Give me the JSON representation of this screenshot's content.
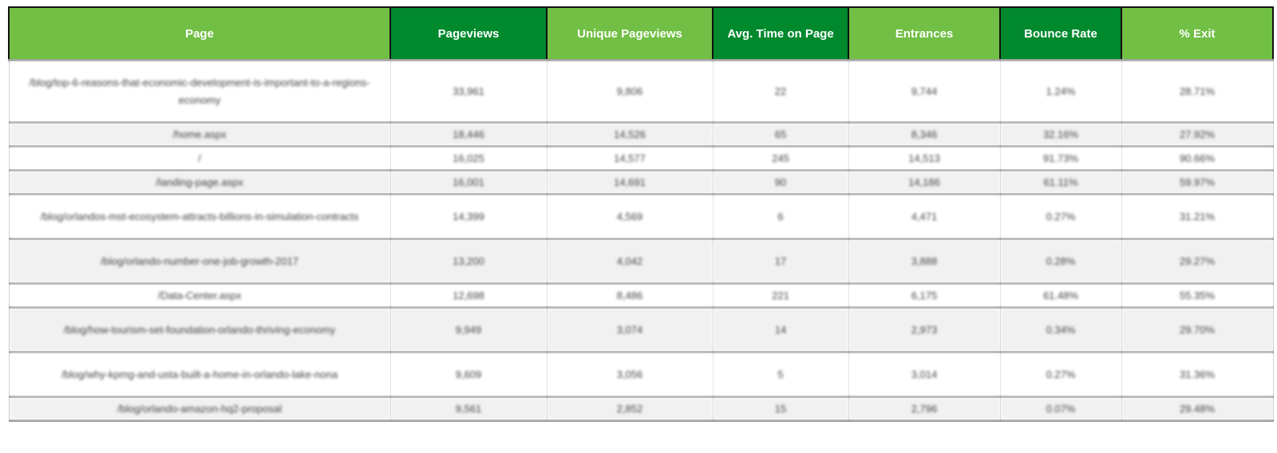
{
  "table": {
    "headers": [
      {
        "label": "Page",
        "style": "light"
      },
      {
        "label": "Pageviews",
        "style": "dark"
      },
      {
        "label": "Unique Pageviews",
        "style": "light"
      },
      {
        "label": "Avg. Time on Page",
        "style": "dark"
      },
      {
        "label": "Entrances",
        "style": "light"
      },
      {
        "label": "Bounce Rate",
        "style": "dark"
      },
      {
        "label": "% Exit",
        "style": "light"
      }
    ],
    "rows": [
      {
        "page": "/blog/top-6-reasons-that-economic-development-is-important-to-a-regions-economy",
        "pageviews": "33,961",
        "unique_pageviews": "9,806",
        "avg_time": "22",
        "entrances": "9,744",
        "bounce_rate": "1.24%",
        "exit": "28.71%"
      },
      {
        "page": "/home.aspx",
        "pageviews": "18,446",
        "unique_pageviews": "14,526",
        "avg_time": "65",
        "entrances": "8,346",
        "bounce_rate": "32.16%",
        "exit": "27.92%"
      },
      {
        "page": "/",
        "pageviews": "16,025",
        "unique_pageviews": "14,577",
        "avg_time": "245",
        "entrances": "14,513",
        "bounce_rate": "91.73%",
        "exit": "90.66%"
      },
      {
        "page": "/landing-page.aspx",
        "pageviews": "16,001",
        "unique_pageviews": "14,691",
        "avg_time": "90",
        "entrances": "14,186",
        "bounce_rate": "61.11%",
        "exit": "59.97%"
      },
      {
        "page": "/blog/orlandos-mst-ecosystem-attracts-billions-in-simulation-contracts",
        "pageviews": "14,399",
        "unique_pageviews": "4,569",
        "avg_time": "6",
        "entrances": "4,471",
        "bounce_rate": "0.27%",
        "exit": "31.21%"
      },
      {
        "page": "/blog/orlando-number-one-job-growth-2017",
        "pageviews": "13,200",
        "unique_pageviews": "4,042",
        "avg_time": "17",
        "entrances": "3,888",
        "bounce_rate": "0.28%",
        "exit": "29.27%"
      },
      {
        "page": "/Data-Center.aspx",
        "pageviews": "12,698",
        "unique_pageviews": "8,486",
        "avg_time": "221",
        "entrances": "6,175",
        "bounce_rate": "61.48%",
        "exit": "55.35%"
      },
      {
        "page": "/blog/how-tourism-set-foundation-orlando-thriving-economy",
        "pageviews": "9,949",
        "unique_pageviews": "3,074",
        "avg_time": "14",
        "entrances": "2,973",
        "bounce_rate": "0.34%",
        "exit": "29.70%"
      },
      {
        "page": "/blog/why-kpmg-and-usta-built-a-home-in-orlando-lake-nona",
        "pageviews": "9,609",
        "unique_pageviews": "3,056",
        "avg_time": "5",
        "entrances": "3,014",
        "bounce_rate": "0.27%",
        "exit": "31.36%"
      },
      {
        "page": "/blog/orlando-amazon-hq2-proposal",
        "pageviews": "9,561",
        "unique_pageviews": "2,852",
        "avg_time": "15",
        "entrances": "2,796",
        "bounce_rate": "0.07%",
        "exit": "29.48%"
      }
    ]
  },
  "colors": {
    "header_light": "#71bf44",
    "header_dark": "#00892d",
    "row_alt": "#f1f1f1"
  }
}
